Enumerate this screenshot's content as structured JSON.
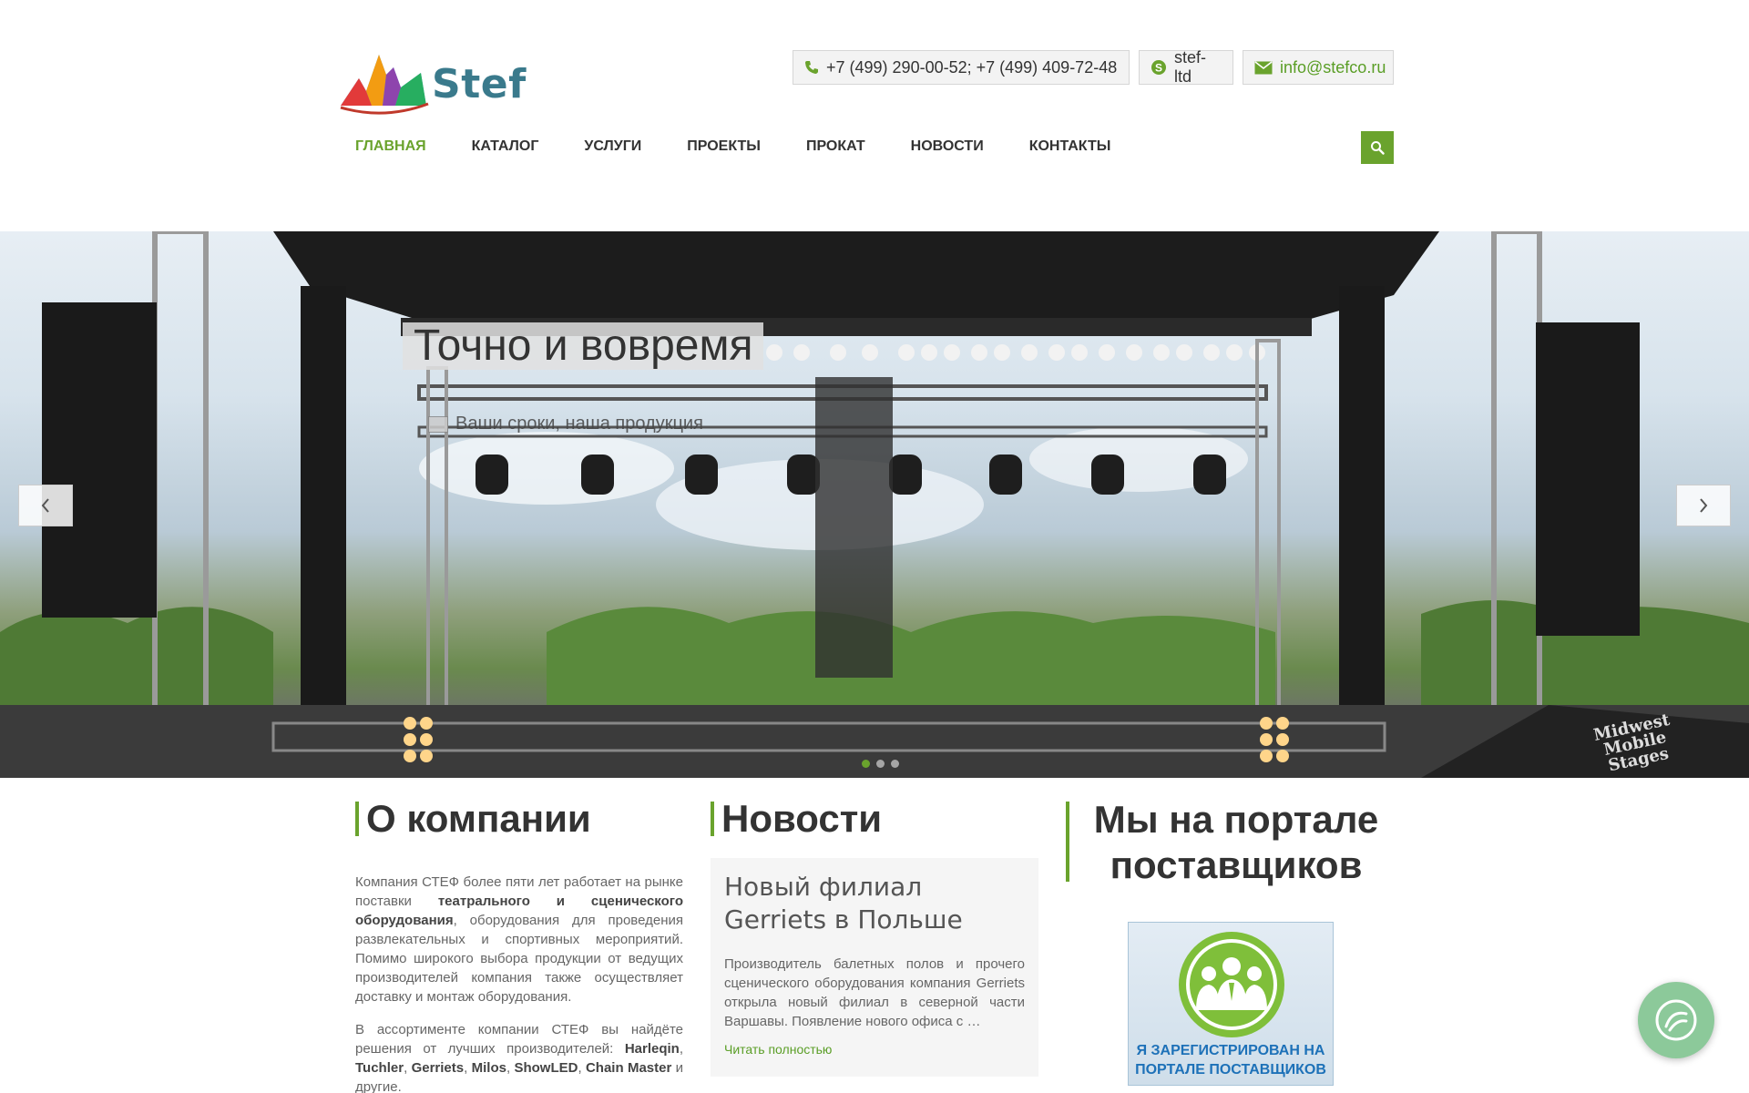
{
  "header": {
    "logo_text": "Stef",
    "contacts": {
      "phone": "+7 (499) 290-00-52; +7 (499) 409-72-48",
      "skype": "stef-ltd",
      "email": "info@stefco.ru"
    },
    "nav": [
      {
        "label": "ГЛАВНАЯ",
        "active": true
      },
      {
        "label": "КАТАЛОГ",
        "active": false
      },
      {
        "label": "УСЛУГИ",
        "active": false
      },
      {
        "label": "ПРОЕКТЫ",
        "active": false
      },
      {
        "label": "ПРОКАТ",
        "active": false
      },
      {
        "label": "НОВОСТИ",
        "active": false
      },
      {
        "label": "КОНТАКТЫ",
        "active": false
      }
    ]
  },
  "slider": {
    "title": "Точно и вовремя",
    "subtitle": "Ваши сроки, наша продукция",
    "dots": 3,
    "active_dot": 0,
    "stage_banner": "Midwest Mobile Stages"
  },
  "about": {
    "title": "О компании",
    "p1_a": "Компания СТЕФ более пяти лет работает на рынке поставки ",
    "p1_b": "театрального и сценического оборудования",
    "p1_c": ", оборудования для проведения развлекательных и спортивных мероприятий. Помимо широкого выбора продукции от ведущих производителей компания также осуществляет доставку и монтаж оборудования.",
    "p2_a": "В ассортименте компании СТЕФ вы найдёте решения от лучших производителей: ",
    "brands": [
      "Harleqin",
      "Tuchler",
      "Gerriets",
      "Milos",
      "ShowLED",
      "Chain Master"
    ],
    "p2_end": " и другие."
  },
  "news": {
    "title": "Новости",
    "item_title": "Новый филиал Gerriets в Польше",
    "item_text": "Производитель балетных полов и прочего сценического оборудования компания Gerriets открыла новый филиал в северной части Варшавы. Появление нового офиса с …",
    "read_more": "Читать полностью"
  },
  "portal": {
    "title": "Мы на портале поставщиков",
    "badge_line1": "Я ЗАРЕГИСТРИРОВАН НА",
    "badge_line2": "ПОРТАЛЕ ПОСТАВЩИКОВ"
  },
  "colors": {
    "accent": "#6aa32d",
    "link": "#5a9e26",
    "portal_blue": "#1d71b8",
    "float_button": "#8cc99a"
  },
  "icons": {
    "phone": "phone-icon",
    "skype": "skype-icon",
    "mail": "envelope-icon",
    "search": "search-icon",
    "prev": "chevron-left-icon",
    "next": "chevron-right-icon",
    "float": "accessibility-icon"
  }
}
